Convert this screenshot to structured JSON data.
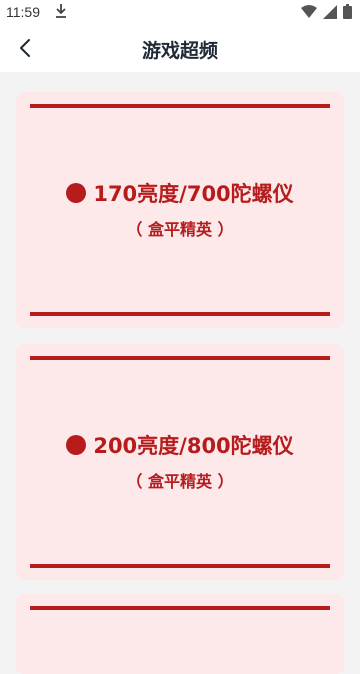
{
  "status_bar": {
    "time": "11:59",
    "download_icon": "download-icon",
    "wifi_icon": "wifi-icon",
    "signal_icon": "signal-icon",
    "battery_icon": "battery-icon"
  },
  "header": {
    "back_icon": "back-arrow-icon",
    "title": "游戏超频"
  },
  "cards": [
    {
      "title": "170亮度/700陀螺仪",
      "subtitle": "（ 盒平精英 ）"
    },
    {
      "title": "200亮度/800陀螺仪",
      "subtitle": "（ 盒平精英 ）"
    },
    {
      "title": "",
      "subtitle": ""
    }
  ],
  "colors": {
    "accent": "#b71c1c",
    "card_background": "#fde8ea",
    "page_background": "#f3f3f4",
    "title_text": "#1f2a36"
  }
}
